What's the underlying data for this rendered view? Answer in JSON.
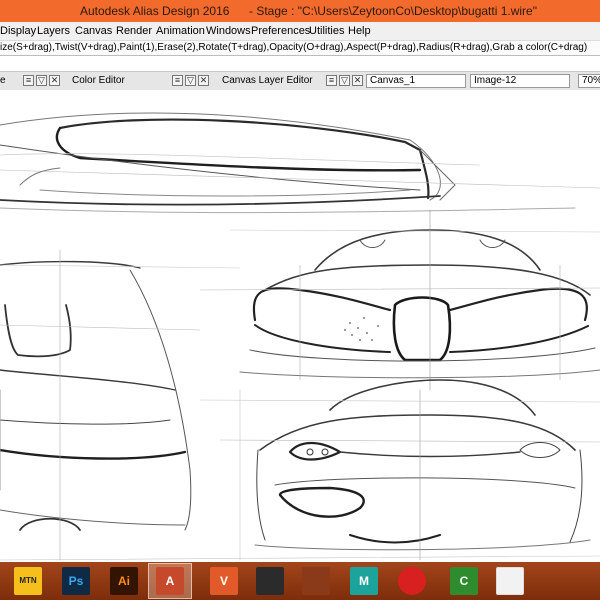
{
  "window": {
    "app_title": "Autodesk Alias Design 2016",
    "stage_title": "- Stage : \"C:\\Users\\ZeytoonCo\\Desktop\\bugatti 1.wire\""
  },
  "menu": {
    "items": [
      "Display",
      "Layers",
      "Canvas",
      "Render",
      "Animation",
      "Windows",
      "Preferences",
      "Utilities",
      "Help"
    ]
  },
  "prompt_line": "ize(S+drag),Twist(V+drag),Paint(1),Erase(2),Rotate(T+drag),Opacity(O+drag),Aspect(P+drag),Radius(R+drag),Grab a color(C+drag)",
  "panels": {
    "left_label": "e",
    "color_editor": "Color Editor",
    "canvas_layer_editor": "Canvas Layer Editor",
    "canvas_field": "Canvas_1",
    "image_field": "Image-12",
    "zoom": "70%",
    "menu_glyph": "≡",
    "arrow_glyph": "▽",
    "close_glyph": "✕"
  },
  "taskbar": {
    "apps": [
      {
        "name": "mtn-irancell-icon",
        "label": "MTN"
      },
      {
        "name": "photoshop-icon",
        "label": "Ps"
      },
      {
        "name": "illustrator-icon",
        "label": "Ai"
      },
      {
        "name": "autodesk-alias-icon",
        "label": "A"
      },
      {
        "name": "vred-icon",
        "label": "V"
      },
      {
        "name": "portrait-app-icon",
        "label": ""
      },
      {
        "name": "sketch-pencil-icon",
        "label": ""
      },
      {
        "name": "maya-icon",
        "label": "M"
      },
      {
        "name": "media-player-icon",
        "label": ""
      },
      {
        "name": "camtasia-icon",
        "label": "C"
      },
      {
        "name": "video-player-icon",
        "label": ""
      }
    ]
  }
}
